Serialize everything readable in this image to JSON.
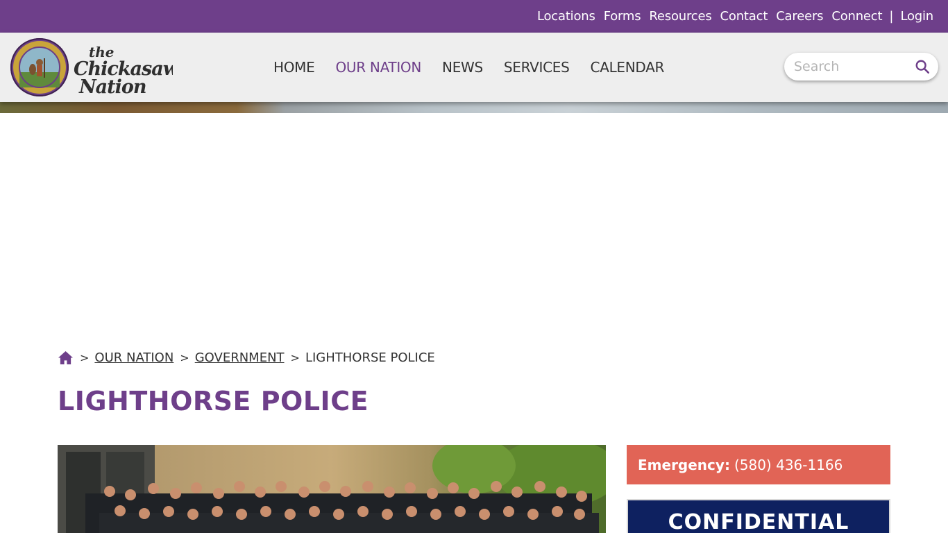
{
  "utility_nav": {
    "items": [
      "Locations",
      "Forms",
      "Resources",
      "Contact",
      "Careers",
      "Connect"
    ],
    "separator": "|",
    "login": "Login"
  },
  "logo": {
    "line1": "the",
    "line2": "Chickasaw",
    "line3": "Nation"
  },
  "main_nav": {
    "items": [
      "HOME",
      "OUR NATION",
      "NEWS",
      "SERVICES",
      "CALENDAR"
    ],
    "active": "OUR NATION"
  },
  "search": {
    "placeholder": "Search",
    "icon": "search-icon"
  },
  "breadcrumb": {
    "home_icon": "home-icon",
    "separator": ">",
    "links": [
      "OUR NATION",
      "GOVERNMENT"
    ],
    "current": "LIGHTHORSE POLICE"
  },
  "page": {
    "title": "LIGHTHORSE POLICE"
  },
  "sidebar": {
    "emergency_label": "Emergency:",
    "emergency_phone": "(580) 436-1166",
    "confidential_heading": "CONFIDENTIAL"
  },
  "colors": {
    "brand_purple": "#6e3f8a",
    "header_gray": "#eeeeee",
    "emergency_red": "#e16456",
    "navy": "#0e2160"
  }
}
